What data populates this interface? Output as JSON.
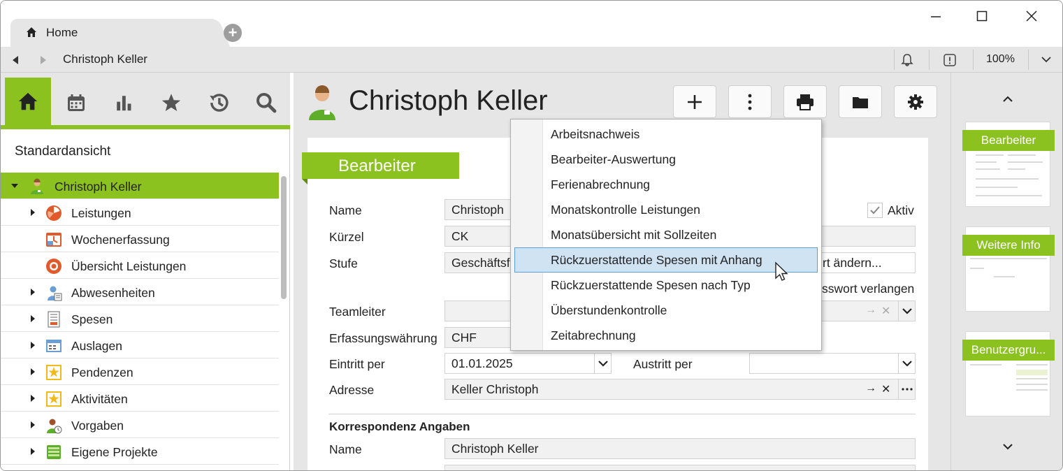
{
  "tab": {
    "label": "Home"
  },
  "address": {
    "text": "Christoph Keller",
    "zoom": "100%"
  },
  "sidebar": {
    "view_title": "Standardansicht",
    "items": [
      {
        "label": "Christoph Keller",
        "icon": "person-icon"
      },
      {
        "label": "Leistungen",
        "icon": "pie-chart-icon"
      },
      {
        "label": "Wochenerfassung",
        "icon": "week-icon"
      },
      {
        "label": "Übersicht Leistungen",
        "icon": "donut-icon"
      },
      {
        "label": "Abwesenheiten",
        "icon": "absence-icon"
      },
      {
        "label": "Spesen",
        "icon": "receipt-icon"
      },
      {
        "label": "Auslagen",
        "icon": "expenses-icon"
      },
      {
        "label": "Pendenzen",
        "icon": "star-task-icon"
      },
      {
        "label": "Aktivitäten",
        "icon": "star-activity-icon"
      },
      {
        "label": "Vorgaben",
        "icon": "specs-icon"
      },
      {
        "label": "Eigene Projekte",
        "icon": "projects-icon"
      }
    ]
  },
  "main": {
    "title": "Christoph Keller",
    "section": "Bearbeiter",
    "fields": {
      "name_label": "Name",
      "name_value": "Christoph",
      "aktiv_label": "Aktiv",
      "kuerzel_label": "Kürzel",
      "kuerzel_value": "CK",
      "stufe_label": "Stufe",
      "stufe_value": "Geschäftsf",
      "pw_button": "rt ändern...",
      "pw_request": "sswort verlangen",
      "teamleiter_label": "Teamleiter",
      "waehrung_label": "Erfassungswährung",
      "waehrung_value": "CHF",
      "eintritt_label": "Eintritt per",
      "eintritt_value": "01.01.2025",
      "austritt_label": "Austritt per",
      "adresse_label": "Adresse",
      "adresse_value": "Keller Christoph",
      "korr_title": "Korrespondenz Angaben",
      "korr_name_label": "Name",
      "korr_name_value": "Christoph Keller"
    }
  },
  "menu": {
    "items": [
      "Arbeitsnachweis",
      "Bearbeiter-Auswertung",
      "Ferienabrechnung",
      "Monatskontrolle Leistungen",
      "Monatsübersicht mit Sollzeiten",
      "Rückzuerstattende Spesen mit Anhang",
      "Rückzuerstattende Spesen nach Typ",
      "Überstundenkontrolle",
      "Zeitabrechnung"
    ],
    "highlighted": "Rückzuerstattende Spesen mit Anhang"
  },
  "right_panel": {
    "thumbs": [
      "Bearbeiter",
      "Weitere Info",
      "Benutzergru..."
    ]
  },
  "colors": {
    "accent": "#8cc220",
    "highlight": "#cfe3f3"
  }
}
